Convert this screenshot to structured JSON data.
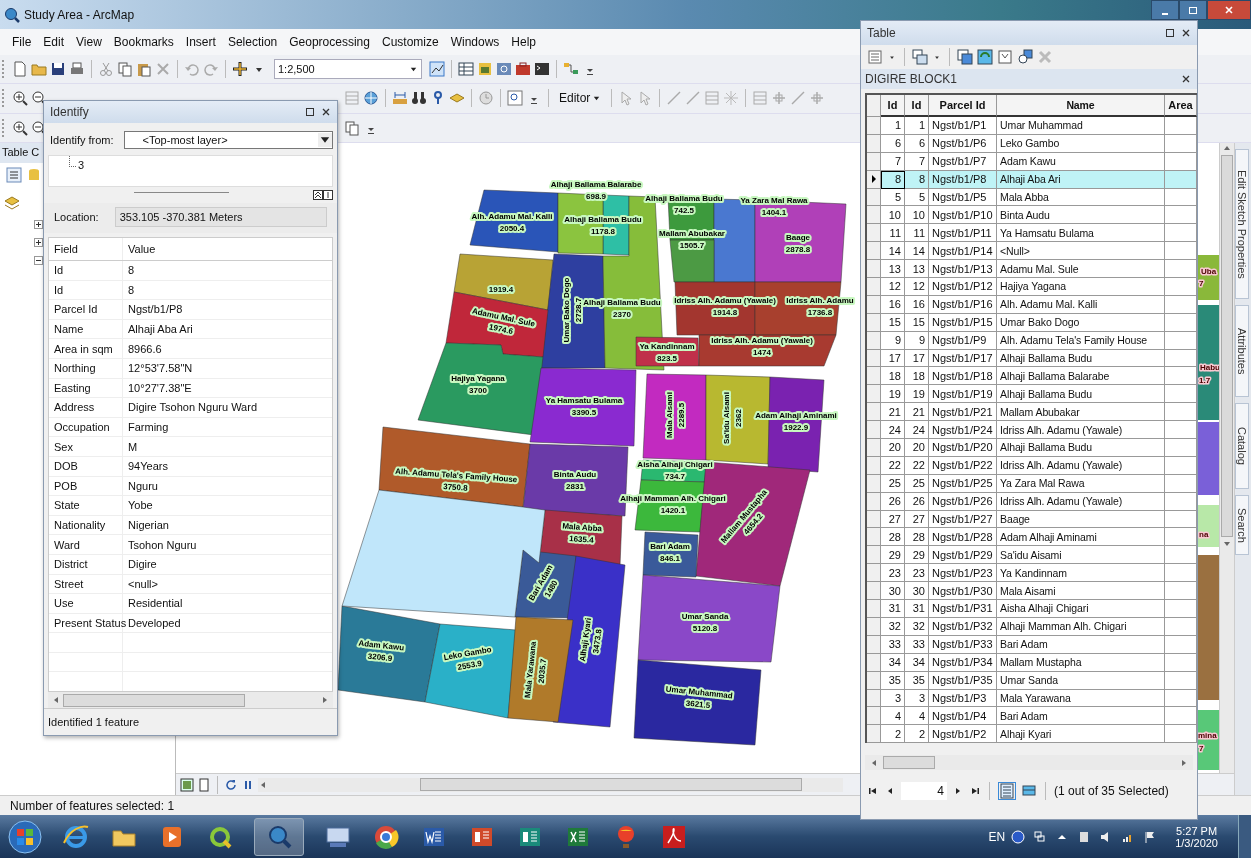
{
  "window": {
    "title": "Study Area - ArcMap"
  },
  "menu": [
    "File",
    "Edit",
    "View",
    "Bookmarks",
    "Insert",
    "Selection",
    "Geoprocessing",
    "Customize",
    "Windows",
    "Help"
  ],
  "toolbar": {
    "scale": "1:2,500",
    "editor": "Editor"
  },
  "toc": {
    "title": "Table C"
  },
  "map": {
    "parcels": [
      {
        "name": "Alhaji Ballama Balarabe",
        "area": "698.9",
        "color": "#2ebfa5"
      },
      {
        "name": "Alh. Adamu Mal. Kalli",
        "area": "2050.4",
        "color": "#2a55b8"
      },
      {
        "name": "Alhaji Ballama Budu",
        "area": "1178.8",
        "color": "#8bc43f"
      },
      {
        "name": "Alhaji Ballama Budu",
        "area": "742.5",
        "color": "#3d9a3d"
      },
      {
        "name": "Ya Zara Mal Rawa",
        "area": "1404.1",
        "color": "#4a78d0"
      },
      {
        "name": "Mallam Abubakar",
        "area": "1505.7",
        "color": "#4c9a44"
      },
      {
        "name": "Baage",
        "area": "2878.8",
        "color": "#b040b8"
      },
      {
        "area": "1919.4",
        "color": "#b8a335"
      },
      {
        "name": "Umar Bako Dogo",
        "area": "2728.7",
        "color": "#2e3fa0"
      },
      {
        "name": "Alhaji Ballama Budu",
        "area": "2370",
        "color": "#86bd3a"
      },
      {
        "name": "Idriss Alh. Adamu (Yawale)",
        "area": "1914.8",
        "color": "#a3362f"
      },
      {
        "name": "Idriss Alh. Adamu",
        "area": "1736.8",
        "color": "#a8402e"
      },
      {
        "name": "Adamu Mal. Sule",
        "area": "1974.6",
        "color": "#c0273a"
      },
      {
        "name": "Ya Kandinnam",
        "area": "823.5",
        "color": "#c0304a"
      },
      {
        "name": "Idriss Alh. Adamu (Yawale)",
        "area": "1474",
        "color": "#a83a30"
      },
      {
        "name": "Hajiya Yagana",
        "area": "3700",
        "color": "#2a9a60"
      },
      {
        "name": "Ya Hamsatu Bulama",
        "area": "3390.5",
        "color": "#8a2ad0"
      },
      {
        "name": "Mala Aisami",
        "area": "2289.5",
        "color": "#c22ac0"
      },
      {
        "name": "Sa'idu Aisami",
        "area": "2362",
        "color": "#b8b830"
      },
      {
        "name": "Adam Alhaji Aminami",
        "area": "1922.9",
        "color": "#7a22b0"
      },
      {
        "name": "Alh. Adamu Tela's Family House",
        "area": "3750.8",
        "color": "#b05a2a"
      },
      {
        "name": "Binta Audu",
        "area": "2831",
        "color": "#6a3aa8"
      },
      {
        "name": "Aisha Alhaji Chigari",
        "area": "734.7",
        "color": "#2ab870"
      },
      {
        "name": "Alhaji Mamman Alh. Chigari",
        "area": "1420.1",
        "color": "#3cb83c"
      },
      {
        "name": "Mallam Mustapha",
        "area": "4654.2",
        "color": "#a0287a"
      },
      {
        "name": "Mala Abba",
        "area": "1635.4",
        "color": "#a83048"
      },
      {
        "name": "Bari Adam",
        "area": "846.1",
        "color": "#3a5a9a"
      },
      {
        "name": "Bari Adam",
        "area": "1480",
        "color": "#3a5a98"
      },
      {
        "name": "Alhaji Kyari",
        "area": "3473.8",
        "color": "#3a30c8"
      },
      {
        "name": "Umar Sanda",
        "area": "5120.8",
        "color": "#8a48c8"
      },
      {
        "name": "Adam Kawu",
        "area": "3206.9",
        "color": "#2a7a98"
      },
      {
        "name": "Leko Gambo",
        "area": "2553.9",
        "color": "#2ab0c8"
      },
      {
        "name": "Mala Yarawana",
        "area": "2035.7",
        "color": "#b07a2a"
      },
      {
        "name": "Umar Muhammad",
        "area": "3621.5",
        "color": "#2a28a0"
      },
      {
        "color": "#c0e6fa"
      }
    ],
    "cut_off_labels": [
      "Uba",
      "7",
      "Habu",
      "1.7",
      "na",
      "mina",
      "7"
    ]
  },
  "identify": {
    "title": "Identify",
    "from_label": "Identify from:",
    "from_value": "<Top-most layer>",
    "tree_item": "3",
    "location_label": "Location:",
    "location_value": "353.105  -370.381 Meters",
    "columns": [
      "Field",
      "Value"
    ],
    "rows": [
      {
        "field": "Id",
        "value": "8"
      },
      {
        "field": "Id",
        "value": "8"
      },
      {
        "field": "Parcel Id",
        "value": "Ngst/b1/P8"
      },
      {
        "field": "Name",
        "value": "Alhaji Aba Ari"
      },
      {
        "field": "Area in sqm",
        "value": "8966.6"
      },
      {
        "field": "Northing",
        "value": "12°53'7.58\"N"
      },
      {
        "field": "Easting",
        "value": "10°27'7.38\"E"
      },
      {
        "field": "Address",
        "value": "Digire Tsohon Nguru Ward"
      },
      {
        "field": "Occupation",
        "value": "Farming"
      },
      {
        "field": "Sex",
        "value": "M"
      },
      {
        "field": "DOB",
        "value": "94Years"
      },
      {
        "field": "POB",
        "value": "Nguru"
      },
      {
        "field": "State",
        "value": "Yobe"
      },
      {
        "field": "Nationality",
        "value": "Nigerian"
      },
      {
        "field": "Ward",
        "value": "Tsohon Nguru"
      },
      {
        "field": "District",
        "value": "Digire"
      },
      {
        "field": "Street",
        "value": "<null>"
      },
      {
        "field": "Use",
        "value": "Residential"
      },
      {
        "field": "Present Status",
        "value": "Developed"
      }
    ],
    "status": "Identified 1 feature"
  },
  "table": {
    "title": "Table",
    "layer": "DIGIRE BLOCK1",
    "columns": [
      "Id",
      "Id",
      "Parcel Id",
      "Name",
      "Area"
    ],
    "rows": [
      {
        "id": "1",
        "id2": "1",
        "parcel_id": "Ngst/b1/P1",
        "name": "Umar Muhammad",
        "selected": false
      },
      {
        "id": "6",
        "id2": "6",
        "parcel_id": "Ngst/b1/P6",
        "name": "Leko Gambo",
        "selected": false
      },
      {
        "id": "7",
        "id2": "7",
        "parcel_id": "Ngst/b1/P7",
        "name": "Adam Kawu",
        "selected": false
      },
      {
        "id": "8",
        "id2": "8",
        "parcel_id": "Ngst/b1/P8",
        "name": "Alhaji Aba Ari",
        "selected": true
      },
      {
        "id": "5",
        "id2": "5",
        "parcel_id": "Ngst/b1/P5",
        "name": "Mala Abba",
        "selected": false
      },
      {
        "id": "10",
        "id2": "10",
        "parcel_id": "Ngst/b1/P10",
        "name": "Binta Audu",
        "selected": false
      },
      {
        "id": "11",
        "id2": "11",
        "parcel_id": "Ngst/b1/P11",
        "name": "Ya Hamsatu Bulama",
        "selected": false
      },
      {
        "id": "14",
        "id2": "14",
        "parcel_id": "Ngst/b1/P14",
        "name": "<Null>",
        "selected": false
      },
      {
        "id": "13",
        "id2": "13",
        "parcel_id": "Ngst/b1/P13",
        "name": "Adamu Mal. Sule",
        "selected": false
      },
      {
        "id": "12",
        "id2": "12",
        "parcel_id": "Ngst/b1/P12",
        "name": "Hajiya Yagana",
        "selected": false
      },
      {
        "id": "16",
        "id2": "16",
        "parcel_id": "Ngst/b1/P16",
        "name": "Alh. Adamu Mal. Kalli",
        "selected": false
      },
      {
        "id": "15",
        "id2": "15",
        "parcel_id": "Ngst/b1/P15",
        "name": "Umar Bako Dogo",
        "selected": false
      },
      {
        "id": "9",
        "id2": "9",
        "parcel_id": "Ngst/b1/P9",
        "name": "Alh. Adamu Tela's Family House",
        "selected": false
      },
      {
        "id": "17",
        "id2": "17",
        "parcel_id": "Ngst/b1/P17",
        "name": "Alhaji Ballama Budu",
        "selected": false
      },
      {
        "id": "18",
        "id2": "18",
        "parcel_id": "Ngst/b1/P18",
        "name": "Alhaji Ballama Balarabe",
        "selected": false
      },
      {
        "id": "19",
        "id2": "19",
        "parcel_id": "Ngst/b1/P19",
        "name": "Alhaji Ballama Budu",
        "selected": false
      },
      {
        "id": "21",
        "id2": "21",
        "parcel_id": "Ngst/b1/P21",
        "name": "Mallam Abubakar",
        "selected": false
      },
      {
        "id": "24",
        "id2": "24",
        "parcel_id": "Ngst/b1/P24",
        "name": "Idriss Alh. Adamu (Yawale)",
        "selected": false
      },
      {
        "id": "20",
        "id2": "20",
        "parcel_id": "Ngst/b1/P20",
        "name": "Alhaji Ballama Budu",
        "selected": false
      },
      {
        "id": "22",
        "id2": "22",
        "parcel_id": "Ngst/b1/P22",
        "name": "Idriss Alh. Adamu (Yawale)",
        "selected": false
      },
      {
        "id": "25",
        "id2": "25",
        "parcel_id": "Ngst/b1/P25",
        "name": "Ya Zara Mal Rawa",
        "selected": false
      },
      {
        "id": "26",
        "id2": "26",
        "parcel_id": "Ngst/b1/P26",
        "name": "Idriss Alh. Adamu (Yawale)",
        "selected": false
      },
      {
        "id": "27",
        "id2": "27",
        "parcel_id": "Ngst/b1/P27",
        "name": "Baage",
        "selected": false
      },
      {
        "id": "28",
        "id2": "28",
        "parcel_id": "Ngst/b1/P28",
        "name": "Adam Alhaji Aminami",
        "selected": false
      },
      {
        "id": "29",
        "id2": "29",
        "parcel_id": "Ngst/b1/P29",
        "name": "Sa'idu Aisami",
        "selected": false
      },
      {
        "id": "23",
        "id2": "23",
        "parcel_id": "Ngst/b1/P23",
        "name": "Ya Kandinnam",
        "selected": false
      },
      {
        "id": "30",
        "id2": "30",
        "parcel_id": "Ngst/b1/P30",
        "name": "Mala Aisami",
        "selected": false
      },
      {
        "id": "31",
        "id2": "31",
        "parcel_id": "Ngst/b1/P31",
        "name": "Aisha Alhaji Chigari",
        "selected": false
      },
      {
        "id": "32",
        "id2": "32",
        "parcel_id": "Ngst/b1/P32",
        "name": "Alhaji Mamman Alh. Chigari",
        "selected": false
      },
      {
        "id": "33",
        "id2": "33",
        "parcel_id": "Ngst/b1/P33",
        "name": "Bari Adam",
        "selected": false
      },
      {
        "id": "34",
        "id2": "34",
        "parcel_id": "Ngst/b1/P34",
        "name": "Mallam Mustapha",
        "selected": false
      },
      {
        "id": "35",
        "id2": "35",
        "parcel_id": "Ngst/b1/P35",
        "name": "Umar Sanda",
        "selected": false
      },
      {
        "id": "3",
        "id2": "3",
        "parcel_id": "Ngst/b1/P3",
        "name": "Mala Yarawana",
        "selected": false
      },
      {
        "id": "4",
        "id2": "4",
        "parcel_id": "Ngst/b1/P4",
        "name": "Bari Adam",
        "selected": false
      },
      {
        "id": "2",
        "id2": "2",
        "parcel_id": "Ngst/b1/P2",
        "name": "Alhaji Kyari",
        "selected": false
      }
    ],
    "record": "4",
    "selection_text": "(1 out of 35 Selected)"
  },
  "dock_tabs": [
    "Edit Sketch Properties",
    "Attributes",
    "Catalog",
    "Search"
  ],
  "status_bar": "Number of features selected: 1",
  "taskbar": {
    "language": "EN",
    "time": "5:27 PM",
    "date": "1/3/2020"
  }
}
